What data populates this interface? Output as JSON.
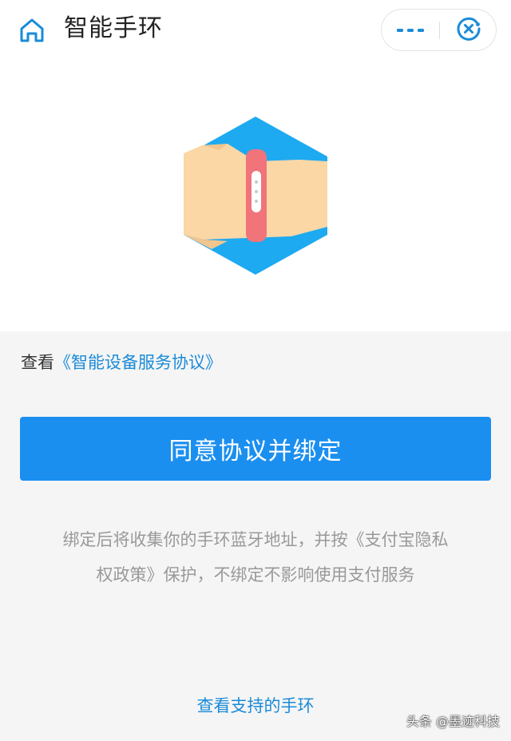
{
  "header": {
    "title": "智能手环",
    "home_icon": "home-icon",
    "more_icon": "more-dots-icon",
    "close_icon": "close-circle-icon"
  },
  "hero": {
    "illustration": "wristband-on-wrist-hexagon-illustration"
  },
  "agreement": {
    "prefix": "查看",
    "link": "《智能设备服务协议》"
  },
  "primary_button": {
    "label": "同意协议并绑定"
  },
  "notice": {
    "line1": "绑定后将收集你的手环蓝牙地址，并按《支付宝隐私",
    "line2": "权政策》保护，不绑定不影响使用支付服务"
  },
  "footer": {
    "supported_link": "查看支持的手环",
    "watermark": "头条 @墨迹科技"
  },
  "colors": {
    "accent": "#1b8ff0",
    "link": "#1a8bd8",
    "hex_blue": "#1daaf0",
    "skin": "#fbd7a6",
    "band": "#f07479"
  }
}
